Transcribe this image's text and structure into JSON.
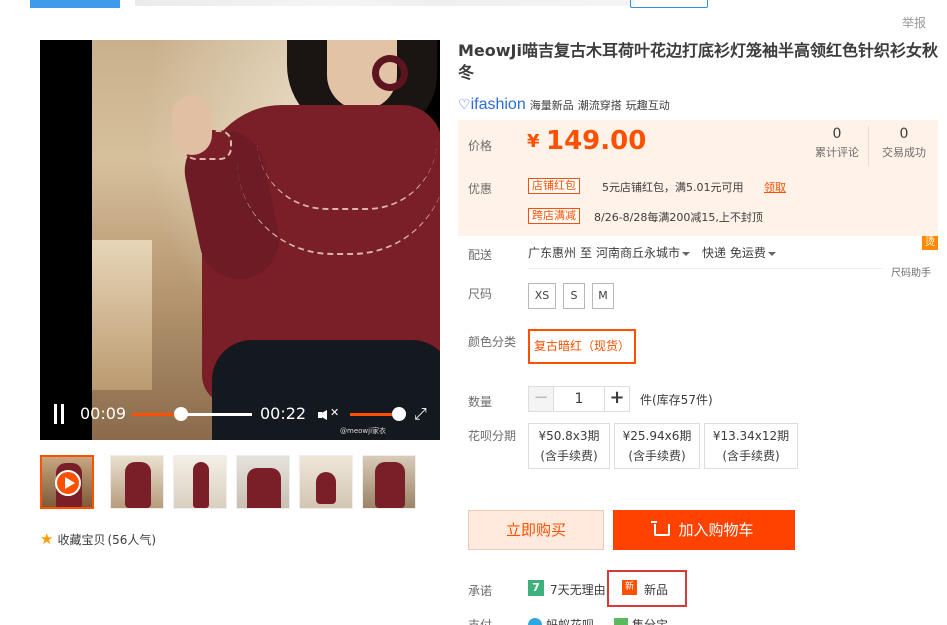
{
  "report": "举报",
  "video": {
    "current_time": "00:09",
    "duration": "00:22",
    "progress": 0.41,
    "volume": 1.0,
    "watermark": "@meowji家衣"
  },
  "thumbnails_count": 6,
  "favorite": {
    "label": "收藏宝贝",
    "count_text": "(56人气)"
  },
  "product": {
    "title": "MeowJi喵吉复古木耳荷叶花边打底衫灯笼袖半高领红色针织衫女秋冬",
    "brand_logo": "ifashion",
    "brand_tags": [
      "海量新品",
      "潮流穿搭",
      "玩趣互动"
    ]
  },
  "price": {
    "label": "价格",
    "currency": "¥",
    "value": "149.00",
    "reviews_count": "0",
    "reviews_label": "累计评论",
    "sales_count": "0",
    "sales_label": "交易成功"
  },
  "promos": {
    "label": "优惠",
    "items": [
      {
        "tag": "店铺红包",
        "text": "5元店铺红包，满5.01元可用",
        "link": "领取"
      },
      {
        "tag": "跨店满减",
        "text": "8/26-8/28每满200减15,上不封顶",
        "link": ""
      }
    ]
  },
  "delivery": {
    "label": "配送",
    "from": "广东惠州",
    "to_word": "至",
    "to": "河南商丘永城市",
    "method": "快递 免运费",
    "size_helper_icon": "烫",
    "size_helper": "尺码助手"
  },
  "size": {
    "label": "尺码",
    "options": [
      "XS",
      "S",
      "M"
    ]
  },
  "color": {
    "label": "颜色分类",
    "selected": "复古暗红（现货）"
  },
  "quantity": {
    "label": "数量",
    "minus": "−",
    "value": "1",
    "plus": "+",
    "stock": "件(库存57件)"
  },
  "installment": {
    "label": "花呗分期",
    "options": [
      {
        "line1": "¥50.8x3期",
        "line2": "(含手续费)"
      },
      {
        "line1": "¥25.94x6期",
        "line2": "(含手续费)"
      },
      {
        "line1": "¥13.34x12期",
        "line2": "(含手续费)"
      }
    ]
  },
  "actions": {
    "buy_now": "立即购买",
    "add_cart": "加入购物车"
  },
  "promise": {
    "label": "承诺",
    "seven_icon": "7",
    "seven_text": "7天无理由",
    "new_icon": "新",
    "new_text": "新品"
  },
  "payment": {
    "label": "支付",
    "methods": [
      "蚂蚁花呗",
      "集分宝"
    ]
  },
  "colors": {
    "accent": "#ff5000",
    "price_bg": "#fff2e8",
    "brand": "#2a6dd8"
  }
}
